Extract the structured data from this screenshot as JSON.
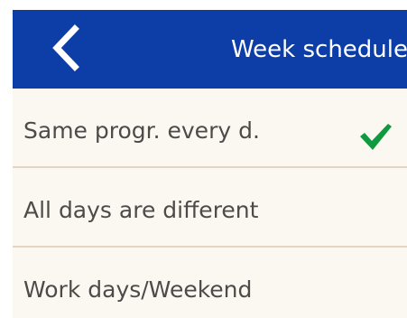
{
  "header": {
    "title": "Week schedule",
    "back_icon": "chevron-left-icon",
    "background_color": "#0d3ea8"
  },
  "options": [
    {
      "label": "Same progr. every d.",
      "selected": true
    },
    {
      "label": "All days are different",
      "selected": false
    },
    {
      "label": "Work days/Weekend",
      "selected": false
    }
  ],
  "selected_icon": "checkmark-icon",
  "colors": {
    "screen_background": "#fbf8f2",
    "divider": "#e5d4c3",
    "text": "#4d4b49",
    "checkmark": "#109a3f"
  }
}
